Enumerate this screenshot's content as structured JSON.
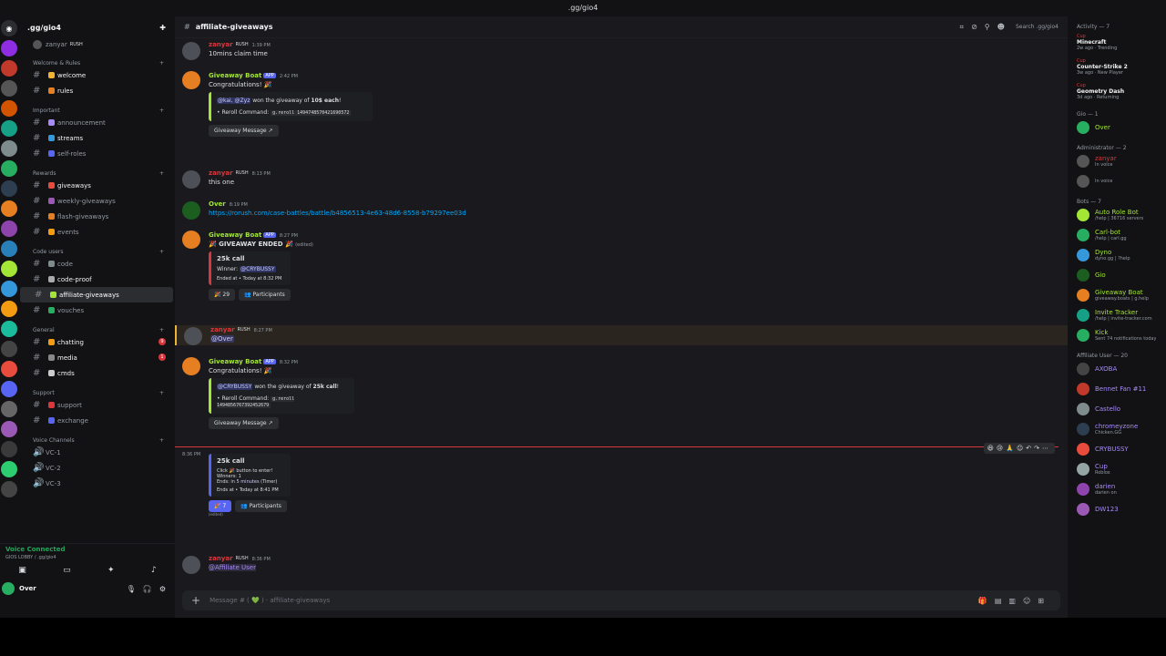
{
  "window_title": ".gg/gio4",
  "server": {
    "name": ".gg/gio4"
  },
  "channels": {
    "top_user": "zanyar",
    "top_user_tag": "RUSH",
    "categories": [
      {
        "name": "Welcome & Rules",
        "items": [
          "welcome",
          "rules"
        ]
      },
      {
        "name": "Important",
        "items": [
          "announcement",
          "streams",
          "self-roles"
        ]
      },
      {
        "name": "Rewards",
        "items": [
          "giveaways",
          "weekly-giveaways",
          "flash-giveaways",
          "events"
        ]
      },
      {
        "name": "Code users",
        "items": [
          "code",
          "code-proof",
          "affiliate-giveaways",
          "vouches"
        ]
      },
      {
        "name": "General",
        "items": [
          "chatting",
          "media",
          "cmds"
        ]
      },
      {
        "name": "Support",
        "items": [
          "support",
          "exchange"
        ]
      },
      {
        "name": "Voice Channels",
        "items": [
          "VC-1",
          "VC-2",
          "VC-3"
        ]
      }
    ]
  },
  "voice": {
    "status": "Voice Connected",
    "location": "GIOS LOBBY / .gg/gio4"
  },
  "user": {
    "name": "Over"
  },
  "header": {
    "channel": "affiliate-giveaways",
    "search_placeholder": "Search .gg/gio4"
  },
  "messages": [
    {
      "author": "zanyar",
      "tag": "RUSH",
      "time": "1:39 PM",
      "text": "10mins claim time"
    },
    {
      "author": "Giveaway Boat",
      "app": "APP",
      "time": "2:42 PM",
      "text": "Congratulations! 🎉",
      "embed": {
        "line1a": "@kai, @Zyz",
        "line1b": " won the giveaway of ",
        "line1c": "10$ each",
        "line1d": "!",
        "reroll_label": "• Reroll Command: ",
        "reroll_code": "g.reroll 1494748570421690572"
      },
      "button": "Giveaway Message"
    },
    {
      "author": "zanyar",
      "tag": "RUSH",
      "time": "8:13 PM",
      "text": "this one"
    },
    {
      "author": "Over",
      "time": "8:19 PM",
      "text": "https://rorush.com/case-battles/battle/b4856513-4e63-48d6-8558-b79297ee03d"
    },
    {
      "author": "Giveaway Boat",
      "app": "APP",
      "time": "8:27 PM",
      "text": "🎉 GIVEAWAY ENDED 🎉",
      "edited": "(edited)",
      "embed": {
        "title": "25k call",
        "winner_label": "Winner: ",
        "winner": "@CRYBUSSY",
        "ended": "Ended at • Today at 8:32 PM"
      },
      "reaction": "29",
      "button": "Participants"
    },
    {
      "author": "zanyar",
      "tag": "RUSH",
      "time": "8:27 PM",
      "text": "@Over"
    },
    {
      "author": "Giveaway Boat",
      "app": "APP",
      "time": "8:32 PM",
      "text": "Congratulations! 🎉",
      "embed": {
        "line1a": "@CRYBUSSY",
        "line1b": " won the giveaway of ",
        "line1c": "25k call",
        "line1d": "!",
        "reroll_label": "• Reroll Command: ",
        "reroll_code": "g.reroll 1494856767392452679"
      },
      "button": "Giveaway Message"
    },
    {
      "time": "8:36 PM",
      "embed": {
        "title": "25k call",
        "l1": "Click 🎉 button to enter!",
        "l2": "Winners: 1",
        "l3a": "Ends: ",
        "l3b": "in 5 minutes",
        "l3c": " (Timer)",
        "l4": "Ends at • Today at 8:41 PM"
      },
      "reaction": "7",
      "button": "Participants",
      "edited": "(edited)"
    },
    {
      "author": "zanyar",
      "tag": "RUSH",
      "time": "8:36 PM",
      "text": "@Affiliate User"
    }
  ],
  "input": {
    "placeholder": "Message # ( 💚 ) · affiliate-giveaways"
  },
  "members": {
    "activity_label": "Activity — 7",
    "activities": [
      {
        "tag": "Cup",
        "game": "Minecraft",
        "meta": "2w ago · Trending"
      },
      {
        "tag": "Cup",
        "game": "Counter-Strike 2",
        "meta": "3w ago · New Player"
      },
      {
        "tag": "Cup",
        "game": "Geometry Dash",
        "meta": "3d ago · Returning"
      }
    ],
    "groups": [
      {
        "label": "Gio — 1",
        "members": [
          {
            "name": "Over",
            "sub": "",
            "color": "#a3e635"
          }
        ]
      },
      {
        "label": "Administrator — 2",
        "members": [
          {
            "name": "zanyar",
            "sub": "In voice",
            "color": "#da373c"
          },
          {
            "name": "",
            "sub": "In voice",
            "color": "#da373c"
          }
        ]
      },
      {
        "label": "Bots — 7",
        "members": [
          {
            "name": "Auto Role Bot",
            "sub": "/help | 36716 servers",
            "color": "#a3e635"
          },
          {
            "name": "Carl-bot",
            "sub": "/help | carl.gg",
            "color": "#a3e635"
          },
          {
            "name": "Dyno",
            "sub": "dyno.gg | ?help",
            "color": "#a3e635"
          },
          {
            "name": "Gio",
            "sub": "",
            "color": "#a3e635"
          },
          {
            "name": "Giveaway Boat",
            "sub": "giveaway.boats | g.help",
            "color": "#a3e635"
          },
          {
            "name": "Invite Tracker",
            "sub": "/help | invite-tracker.com",
            "color": "#a3e635"
          },
          {
            "name": "Kick",
            "sub": "Sent 74 notifications today",
            "color": "#a3e635"
          }
        ]
      },
      {
        "label": "Affiliate User — 20",
        "members": [
          {
            "name": "AXOBA",
            "sub": "",
            "color": "#a78bfa"
          },
          {
            "name": "Bennet Fan #11",
            "sub": "",
            "color": "#a78bfa"
          },
          {
            "name": "Castello",
            "sub": "",
            "color": "#a78bfa"
          },
          {
            "name": "chromeyzone",
            "sub": "Chicken.GG",
            "color": "#a78bfa"
          },
          {
            "name": "CRYBUSSY",
            "sub": "",
            "color": "#a78bfa"
          },
          {
            "name": "Cup",
            "sub": "Roblox",
            "color": "#a78bfa"
          },
          {
            "name": "darien",
            "sub": "darien on",
            "color": "#a78bfa"
          },
          {
            "name": "DW123",
            "sub": "",
            "color": "#a78bfa"
          }
        ]
      }
    ]
  },
  "colors": {
    "accent": "#5865f2",
    "bot_green": "#a3e635",
    "admin_red": "#da373c",
    "affiliate": "#a78bfa"
  }
}
